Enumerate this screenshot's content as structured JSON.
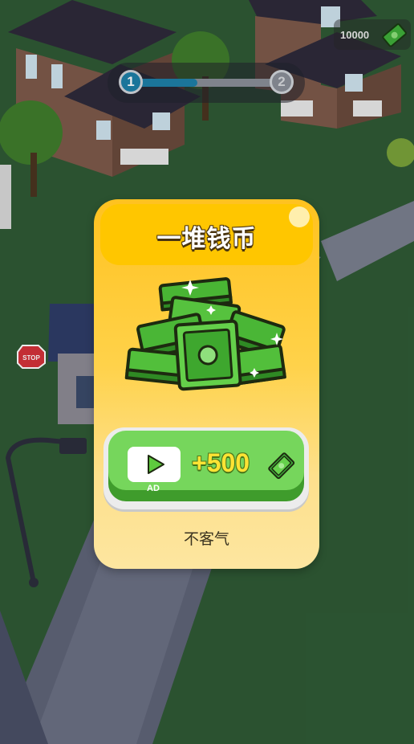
{
  "hud": {
    "cash_amount": "10000",
    "level_current": "1",
    "level_next": "2",
    "level_progress": 0.45
  },
  "popup": {
    "title": "一堆钱币",
    "ad_label": "AD",
    "reward_text": "+500",
    "decline_text": "不客气"
  },
  "colors": {
    "modal_top": "#ffc21f",
    "modal_bottom": "#fde6a0",
    "button_green": "#76d65c",
    "reward_yellow": "#ffe334",
    "progress_blue": "#1e7fa8"
  },
  "icons": {
    "cash": "cash-icon",
    "play": "play-icon",
    "money_pile": "money-pile-icon"
  }
}
